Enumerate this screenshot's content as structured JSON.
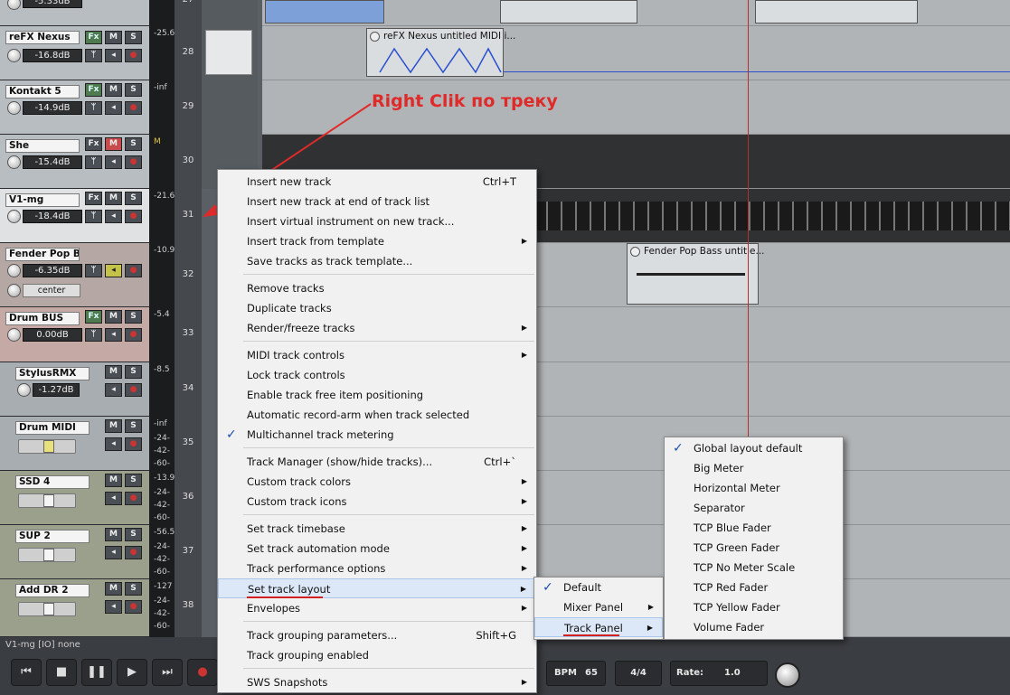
{
  "annotation": "Right Clik по треку",
  "status_bar": "V1-mg [IO] none",
  "tracks": [
    {
      "name": "reFX Nexus",
      "volume": "-16.8dB",
      "meter": "-25.6",
      "number": "28"
    },
    {
      "name": "Kontakt 5",
      "volume": "-14.9dB",
      "meter": "-inf",
      "number": "29"
    },
    {
      "name": "She",
      "volume": "-15.4dB",
      "meter": "M",
      "number": "30"
    },
    {
      "name": "V1-mg",
      "volume": "-18.4dB",
      "meter": "-21.6",
      "number": "31"
    },
    {
      "name": "Fender Pop Bass",
      "volume": "-6.35dB",
      "pan": "center",
      "meter": "-10.9",
      "number": "32"
    },
    {
      "name": "Drum BUS",
      "volume": "0.00dB",
      "meter": "-5.4",
      "number": "33"
    },
    {
      "name": "StylusRMX",
      "volume": "-1.27dB",
      "meter": "-8.5",
      "number": "34"
    },
    {
      "name": "Drum MIDI",
      "meter": "-inf",
      "number": "35"
    },
    {
      "name": "SSD 4",
      "meter": "-13.9",
      "number": "36"
    },
    {
      "name": "SUP 2",
      "meter": "-56.5",
      "number": "37"
    },
    {
      "name": "Add DR 2",
      "meter": "-127",
      "number": "38"
    }
  ],
  "top_partial_track": {
    "volume": "-5.33dB",
    "number": "27"
  },
  "meter_scale": [
    "-24-",
    "-42-",
    "-60-"
  ],
  "buttons": {
    "fx": "Fx",
    "mute": "M",
    "solo": "S"
  },
  "items": {
    "nexus": "reFX Nexus untitled MIDI i...",
    "fender": "Fender Pop Bass untitle..."
  },
  "context_menu": {
    "groups": [
      [
        {
          "label": "Insert new track",
          "shortcut": "Ctrl+T"
        },
        {
          "label": "Insert new track at end of track list"
        },
        {
          "label": "Insert virtual instrument on new track..."
        },
        {
          "label": "Insert track from template",
          "submenu": true
        },
        {
          "label": "Save tracks as track template..."
        }
      ],
      [
        {
          "label": "Remove tracks"
        },
        {
          "label": "Duplicate tracks"
        },
        {
          "label": "Render/freeze tracks",
          "submenu": true
        }
      ],
      [
        {
          "label": "MIDI track controls",
          "submenu": true
        },
        {
          "label": "Lock track controls"
        },
        {
          "label": "Enable track free item positioning"
        },
        {
          "label": "Automatic record-arm when track selected"
        },
        {
          "label": "Multichannel track metering",
          "checked": true
        }
      ],
      [
        {
          "label": "Track Manager (show/hide tracks)...",
          "shortcut": "Ctrl+`"
        },
        {
          "label": "Custom track colors",
          "submenu": true
        },
        {
          "label": "Custom track icons",
          "submenu": true
        }
      ],
      [
        {
          "label": "Set track timebase",
          "submenu": true
        },
        {
          "label": "Set track automation mode",
          "submenu": true
        },
        {
          "label": "Track performance options",
          "submenu": true
        },
        {
          "label": "Set track layout",
          "submenu": true,
          "highlighted": true
        },
        {
          "label": "Envelopes",
          "submenu": true
        }
      ],
      [
        {
          "label": "Track grouping parameters...",
          "shortcut": "Shift+G"
        },
        {
          "label": "Track grouping enabled"
        }
      ],
      [
        {
          "label": "SWS Snapshots",
          "submenu": true
        }
      ]
    ]
  },
  "layout_menu": [
    {
      "label": "Default",
      "checked": true
    },
    {
      "label": "Mixer Panel",
      "submenu": true
    },
    {
      "label": "Track Panel",
      "submenu": true,
      "highlighted": true
    }
  ],
  "track_panel_menu": [
    {
      "label": "Global layout default",
      "checked": true
    },
    {
      "label": "Big Meter"
    },
    {
      "label": "Horizontal Meter"
    },
    {
      "label": "Separator"
    },
    {
      "label": "TCP Blue Fader"
    },
    {
      "label": "TCP Green Fader"
    },
    {
      "label": "TCP No Meter Scale"
    },
    {
      "label": "TCP Red Fader"
    },
    {
      "label": "TCP Yellow Fader"
    },
    {
      "label": "Volume Fader"
    }
  ],
  "transport": {
    "bpm_label": "BPM",
    "bpm_value": "65",
    "time_sig": "4/4",
    "rate_label": "Rate:",
    "rate_value": "1.0"
  },
  "icons": {
    "submenu_arrow": "▶",
    "check": "✓"
  },
  "colors": {
    "annotation": "#e02a2a",
    "selected_track": "#dfe1e3",
    "menu_highlight": "#dce8f7"
  }
}
